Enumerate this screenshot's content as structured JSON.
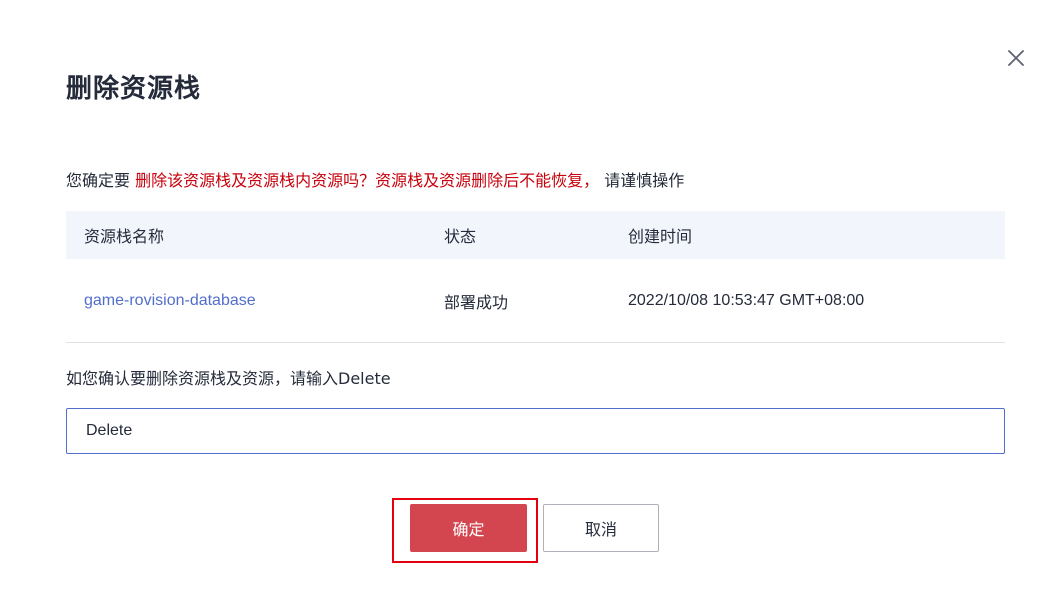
{
  "dialog": {
    "title": "删除资源栈",
    "close_icon": "close-icon"
  },
  "warning": {
    "prefix": "您确定要 ",
    "danger_text": "删除该资源栈及资源栈内资源吗？资源栈及资源删除后不能恢复，",
    "suffix": " 请谨慎操作"
  },
  "table": {
    "headers": [
      "资源栈名称",
      "状态",
      "创建时间"
    ],
    "rows": [
      {
        "name": "game-rovision-database",
        "status": "部署成功",
        "created": "2022/10/08 10:53:47 GMT+08:00"
      }
    ]
  },
  "confirm": {
    "label": "如您确认要删除资源栈及资源，请输入Delete",
    "value": "Delete"
  },
  "buttons": {
    "ok": "确定",
    "cancel": "取消"
  },
  "colors": {
    "danger": "#c7000b",
    "primary_button": "#d4464f",
    "link": "#526ecc",
    "table_header_bg": "#f2f5fc",
    "highlight": "#e3000f"
  }
}
